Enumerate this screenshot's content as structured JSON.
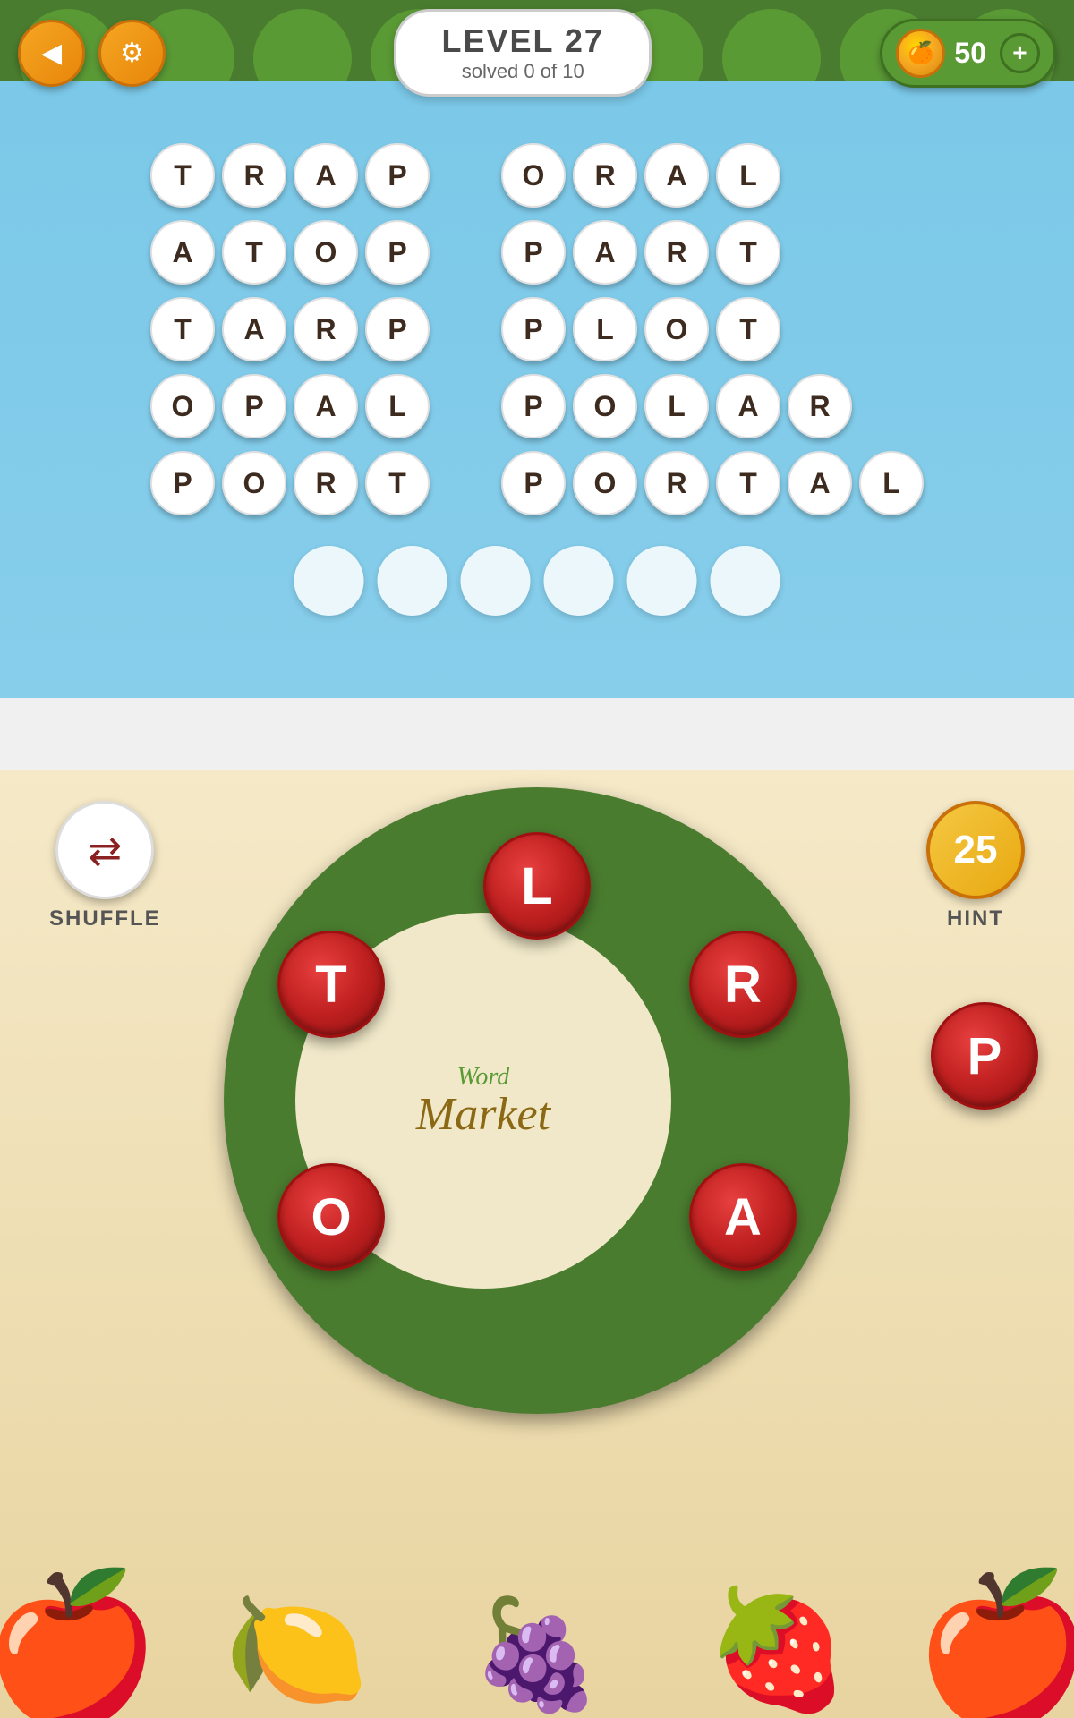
{
  "header": {
    "level_title": "LEVEL 27",
    "level_sub": "solved 0 of 10",
    "coin_count": "50",
    "coin_plus": "+"
  },
  "words": {
    "column1": [
      [
        "T",
        "R",
        "A",
        "P"
      ],
      [
        "A",
        "T",
        "O",
        "P"
      ],
      [
        "T",
        "A",
        "R",
        "P"
      ],
      [
        "O",
        "P",
        "A",
        "L"
      ],
      [
        "P",
        "O",
        "R",
        "T"
      ]
    ],
    "column2": [
      [
        "O",
        "R",
        "A",
        "L"
      ],
      [
        "P",
        "A",
        "R",
        "T"
      ],
      [
        "P",
        "L",
        "O",
        "T"
      ],
      [
        "P",
        "O",
        "L",
        "A",
        "R"
      ],
      [
        "P",
        "O",
        "R",
        "T",
        "A",
        "L"
      ]
    ]
  },
  "answer_slots": 6,
  "wheel": {
    "letters": [
      "L",
      "R",
      "A",
      "P",
      "O",
      "T"
    ],
    "brand_word": "Word",
    "brand_market": "Market"
  },
  "shuffle": {
    "label": "SHUFFLE"
  },
  "hint": {
    "label": "HINT",
    "count": "25"
  }
}
